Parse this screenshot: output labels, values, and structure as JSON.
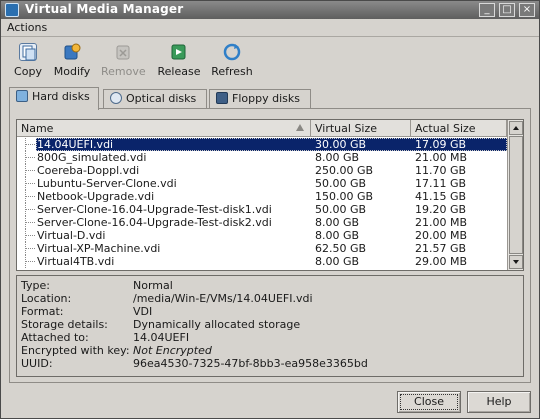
{
  "window": {
    "title": "Virtual Media Manager",
    "controls": {
      "minimize": "_",
      "maximize": "□",
      "close": "×"
    }
  },
  "menu": {
    "actions": "Actions"
  },
  "toolbar": {
    "copy": "Copy",
    "modify": "Modify",
    "remove": "Remove",
    "release": "Release",
    "refresh": "Refresh"
  },
  "tabs": {
    "hard_disks": "Hard disks",
    "optical_disks": "Optical disks",
    "floppy_disks": "Floppy disks"
  },
  "table": {
    "headers": {
      "name": "Name",
      "virtual_size": "Virtual Size",
      "actual_size": "Actual Size"
    },
    "rows": [
      {
        "name": "14.04UEFI.vdi",
        "virtual": "30.00 GB",
        "actual": "17.09 GB"
      },
      {
        "name": "800G_simulated.vdi",
        "virtual": "8.00 GB",
        "actual": "21.00 MB"
      },
      {
        "name": "Coereba-Doppl.vdi",
        "virtual": "250.00 GB",
        "actual": "11.70 GB"
      },
      {
        "name": "Lubuntu-Server-Clone.vdi",
        "virtual": "50.00 GB",
        "actual": "17.11 GB"
      },
      {
        "name": "Netbook-Upgrade.vdi",
        "virtual": "150.00 GB",
        "actual": "41.15 GB"
      },
      {
        "name": "Server-Clone-16.04-Upgrade-Test-disk1.vdi",
        "virtual": "50.00 GB",
        "actual": "19.20 GB"
      },
      {
        "name": "Server-Clone-16.04-Upgrade-Test-disk2.vdi",
        "virtual": "8.00 GB",
        "actual": "21.00 MB"
      },
      {
        "name": "Virtual-D.vdi",
        "virtual": "8.00 GB",
        "actual": "20.00 MB"
      },
      {
        "name": "Virtual-XP-Machine.vdi",
        "virtual": "62.50 GB",
        "actual": "21.57 GB"
      },
      {
        "name": "Virtual4TB.vdi",
        "virtual": "8.00 GB",
        "actual": "29.00 MB"
      }
    ]
  },
  "details": {
    "type_label": "Type:",
    "type_value": "Normal",
    "location_label": "Location:",
    "location_value": "/media/Win-E/VMs/14.04UEFI.vdi",
    "format_label": "Format:",
    "format_value": "VDI",
    "storage_label": "Storage details:",
    "storage_value": "Dynamically allocated storage",
    "attached_label": "Attached to:",
    "attached_value": "14.04UEFI",
    "encrypted_label": "Encrypted with key:",
    "encrypted_value": "Not Encrypted",
    "uuid_label": "UUID:",
    "uuid_value": "96ea4530-7325-47bf-8bb3-ea958e3365bd"
  },
  "buttons": {
    "close": "Close",
    "help": "Help"
  },
  "colors": {
    "selection": "#0a246a",
    "titlebar": "#6e6e6e",
    "background": "#d6d3ce"
  }
}
